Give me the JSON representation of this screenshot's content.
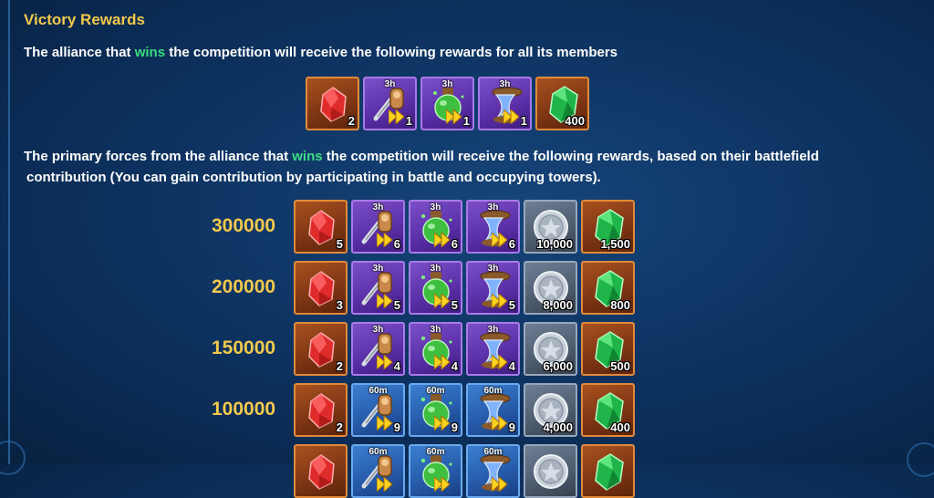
{
  "title": "Victory Rewards",
  "desc1": {
    "before": "The alliance that ",
    "highlight": "wins",
    "after": " the competition will receive the following rewards for all its members"
  },
  "desc2": {
    "before": "The primary forces from the alliance that ",
    "highlight": "wins",
    "after": " the competition will receive the following rewards, based on their battlefield",
    "line2": "contribution (You can gain contribution by participating in battle and occupying towers)."
  },
  "member_rewards": [
    {
      "icon": "ruby-icon",
      "frame": "orange",
      "qty": "2",
      "tag": ""
    },
    {
      "icon": "sword-speedup-icon",
      "frame": "purple",
      "qty": "1",
      "tag": "3h"
    },
    {
      "icon": "potion-speedup-icon",
      "frame": "purple",
      "qty": "1",
      "tag": "3h"
    },
    {
      "icon": "hourglass-speedup-icon",
      "frame": "purple",
      "qty": "1",
      "tag": "3h"
    },
    {
      "icon": "emerald-icon",
      "frame": "orange",
      "qty": "400",
      "tag": ""
    }
  ],
  "tiers": [
    {
      "threshold": "300000",
      "rewards": [
        {
          "icon": "ruby-icon",
          "frame": "orange",
          "qty": "5",
          "tag": ""
        },
        {
          "icon": "sword-speedup-icon",
          "frame": "purple",
          "qty": "6",
          "tag": "3h"
        },
        {
          "icon": "potion-speedup-icon",
          "frame": "purple",
          "qty": "6",
          "tag": "3h"
        },
        {
          "icon": "hourglass-speedup-icon",
          "frame": "purple",
          "qty": "6",
          "tag": "3h"
        },
        {
          "icon": "silver-coin-icon",
          "frame": "grey",
          "qty": "10,000",
          "tag": ""
        },
        {
          "icon": "emerald-icon",
          "frame": "orange",
          "qty": "1,500",
          "tag": ""
        }
      ]
    },
    {
      "threshold": "200000",
      "rewards": [
        {
          "icon": "ruby-icon",
          "frame": "orange",
          "qty": "3",
          "tag": ""
        },
        {
          "icon": "sword-speedup-icon",
          "frame": "purple",
          "qty": "5",
          "tag": "3h"
        },
        {
          "icon": "potion-speedup-icon",
          "frame": "purple",
          "qty": "5",
          "tag": "3h"
        },
        {
          "icon": "hourglass-speedup-icon",
          "frame": "purple",
          "qty": "5",
          "tag": "3h"
        },
        {
          "icon": "silver-coin-icon",
          "frame": "grey",
          "qty": "8,000",
          "tag": ""
        },
        {
          "icon": "emerald-icon",
          "frame": "orange",
          "qty": "800",
          "tag": ""
        }
      ]
    },
    {
      "threshold": "150000",
      "rewards": [
        {
          "icon": "ruby-icon",
          "frame": "orange",
          "qty": "2",
          "tag": ""
        },
        {
          "icon": "sword-speedup-icon",
          "frame": "purple",
          "qty": "4",
          "tag": "3h"
        },
        {
          "icon": "potion-speedup-icon",
          "frame": "purple",
          "qty": "4",
          "tag": "3h"
        },
        {
          "icon": "hourglass-speedup-icon",
          "frame": "purple",
          "qty": "4",
          "tag": "3h"
        },
        {
          "icon": "silver-coin-icon",
          "frame": "grey",
          "qty": "6,000",
          "tag": ""
        },
        {
          "icon": "emerald-icon",
          "frame": "orange",
          "qty": "500",
          "tag": ""
        }
      ]
    },
    {
      "threshold": "100000",
      "rewards": [
        {
          "icon": "ruby-icon",
          "frame": "orange",
          "qty": "2",
          "tag": ""
        },
        {
          "icon": "sword-speedup-icon",
          "frame": "blue",
          "qty": "9",
          "tag": "60m"
        },
        {
          "icon": "potion-speedup-icon",
          "frame": "blue",
          "qty": "9",
          "tag": "60m"
        },
        {
          "icon": "hourglass-speedup-icon",
          "frame": "blue",
          "qty": "9",
          "tag": "60m"
        },
        {
          "icon": "silver-coin-icon",
          "frame": "grey",
          "qty": "4,000",
          "tag": ""
        },
        {
          "icon": "emerald-icon",
          "frame": "orange",
          "qty": "400",
          "tag": ""
        }
      ]
    },
    {
      "threshold": "",
      "rewards": [
        {
          "icon": "ruby-icon",
          "frame": "orange",
          "qty": "",
          "tag": ""
        },
        {
          "icon": "sword-speedup-icon",
          "frame": "blue",
          "qty": "",
          "tag": "60m"
        },
        {
          "icon": "potion-speedup-icon",
          "frame": "blue",
          "qty": "",
          "tag": "60m"
        },
        {
          "icon": "hourglass-speedup-icon",
          "frame": "blue",
          "qty": "",
          "tag": "60m"
        },
        {
          "icon": "silver-coin-icon",
          "frame": "grey",
          "qty": "",
          "tag": ""
        },
        {
          "icon": "emerald-icon",
          "frame": "orange",
          "qty": "",
          "tag": ""
        }
      ]
    }
  ]
}
